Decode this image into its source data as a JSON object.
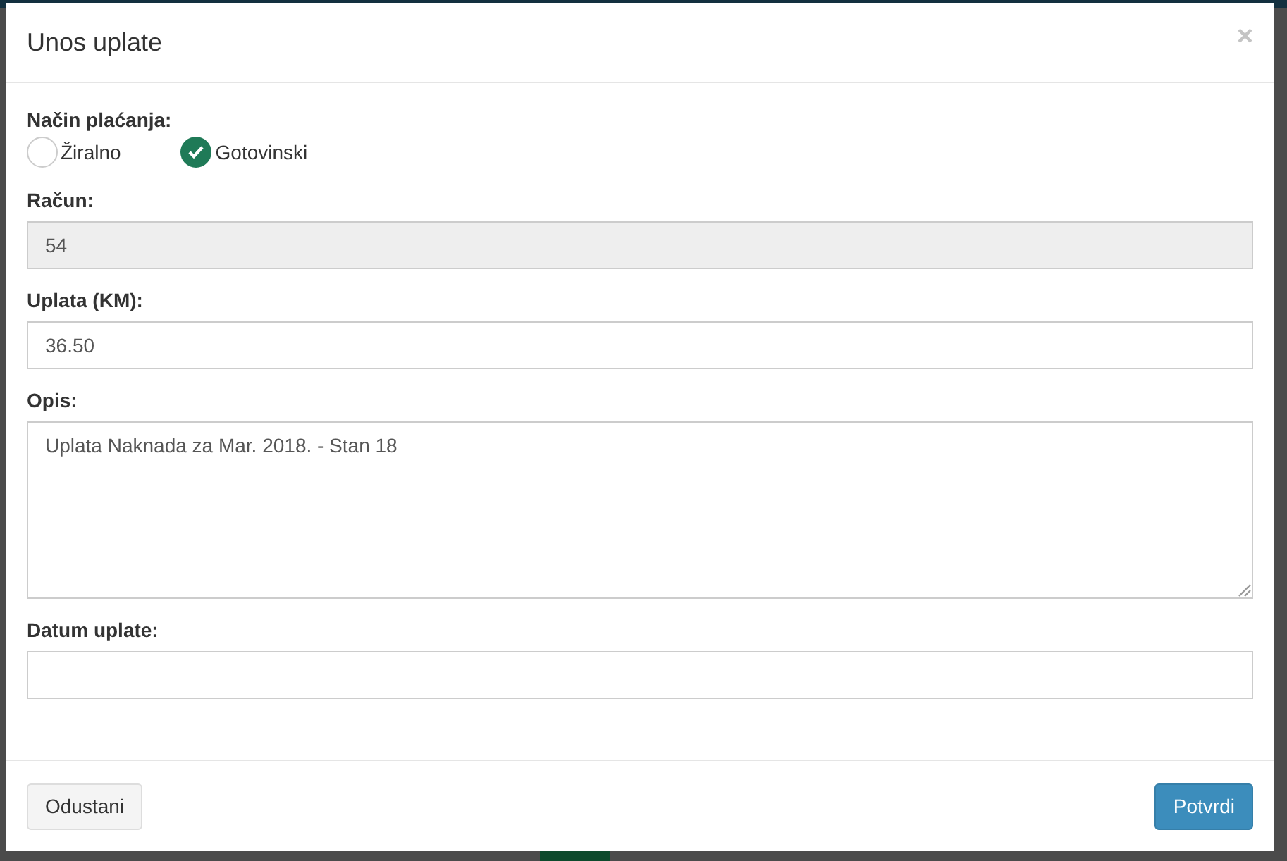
{
  "dialog": {
    "title": "Unos uplate",
    "close": "×",
    "payment_method": {
      "label": "Način plaćanja:",
      "options": [
        {
          "label": "Žiralno",
          "selected": false
        },
        {
          "label": "Gotovinski",
          "selected": true
        }
      ]
    },
    "fields": [
      {
        "kind": "input",
        "label": "Račun:",
        "value": "54",
        "disabled": true
      },
      {
        "kind": "input",
        "label": "Uplata (KM):",
        "value": "36.50",
        "disabled": false
      },
      {
        "kind": "textarea",
        "label": "Opis:",
        "value": "Uplata Naknada za Mar. 2018. - Stan 18",
        "disabled": false
      },
      {
        "kind": "input",
        "label": "Datum uplate:",
        "disabled": false
      }
    ],
    "buttons": {
      "cancel": "Odustani",
      "confirm": "Potvrdi"
    }
  }
}
